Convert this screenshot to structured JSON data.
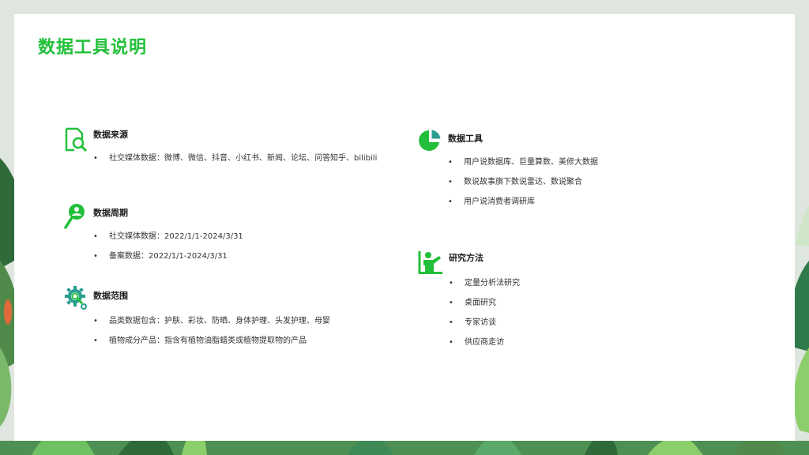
{
  "title": "数据工具说明",
  "colors": {
    "accent": "#22c03a",
    "icon_teal": "#2a9d8f",
    "text": "#1a1a1a"
  },
  "sections": {
    "source": {
      "icon": "document-search-icon",
      "title": "数据来源",
      "items": [
        "社交媒体数据：微博、微信、抖音、小红书、新闻、论坛、问答知乎、bilibili"
      ]
    },
    "period": {
      "icon": "person-magnifier-icon",
      "title": "数据周期",
      "items": [
        "社交媒体数据：2022/1/1-2024/3/31",
        "备案数据：2022/1/1-2024/3/31"
      ]
    },
    "scope": {
      "icon": "gear-search-icon",
      "title": "数据范围",
      "items": [
        "品类数据包含：护肤、彩妆、防晒、身体护理、头发护理、母婴",
        "植物成分产品：指含有植物油脂蜡类或植物提取物的产品"
      ]
    },
    "tools": {
      "icon": "pie-chart-icon",
      "title": "数据工具",
      "items": [
        "用户说数据库、巨量算数、美修大数据",
        "数说故事旗下数说雷达、数说聚合",
        "用户说消费者调研库"
      ]
    },
    "methods": {
      "icon": "presenter-icon",
      "title": "研究方法",
      "items": [
        "定量分析法研究",
        "桌面研究",
        "专家访谈",
        "供应商走访"
      ]
    }
  }
}
